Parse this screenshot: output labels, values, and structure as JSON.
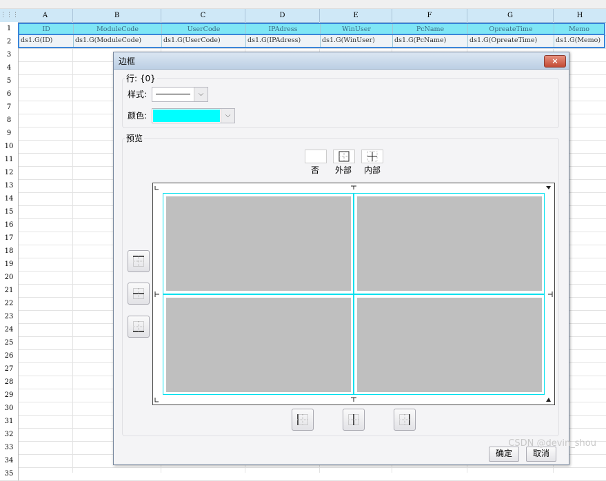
{
  "sheet": {
    "columns": [
      "A",
      "B",
      "C",
      "D",
      "E",
      "F",
      "G",
      "H"
    ],
    "rows": [
      "1",
      "2",
      "3",
      "4",
      "5",
      "6",
      "7",
      "8",
      "9",
      "10",
      "11",
      "12",
      "13",
      "14",
      "15",
      "16",
      "17",
      "18",
      "19",
      "20",
      "21",
      "22",
      "23",
      "24",
      "25",
      "26",
      "27",
      "28",
      "29",
      "30",
      "31",
      "32",
      "33",
      "34",
      "35"
    ],
    "header_row": [
      "ID",
      "ModuleCode",
      "UserCode",
      "IPAdress",
      "WinUser",
      "PcName",
      "OpreateTime",
      "Memo"
    ],
    "data_row": [
      "ds1.G(ID)",
      "ds1.G(ModuleCode)",
      "ds1.G(UserCode)",
      "ds1.G(IPAdress)",
      "ds1.G(WinUser)",
      "ds1.G(PcName)",
      "ds1.G(OpreateTime)",
      "ds1.G(Memo)"
    ]
  },
  "dialog": {
    "title": "边框",
    "close_label": "×",
    "row_group_label": "行: {0}",
    "style_label": "样式:",
    "color_label": "颜色:",
    "color_value": "#00ffff",
    "preview_group_label": "预览",
    "presets": [
      "否",
      "外部",
      "内部"
    ],
    "ok_label": "确定",
    "cancel_label": "取消"
  },
  "watermark": "CSDN @devin_shou"
}
